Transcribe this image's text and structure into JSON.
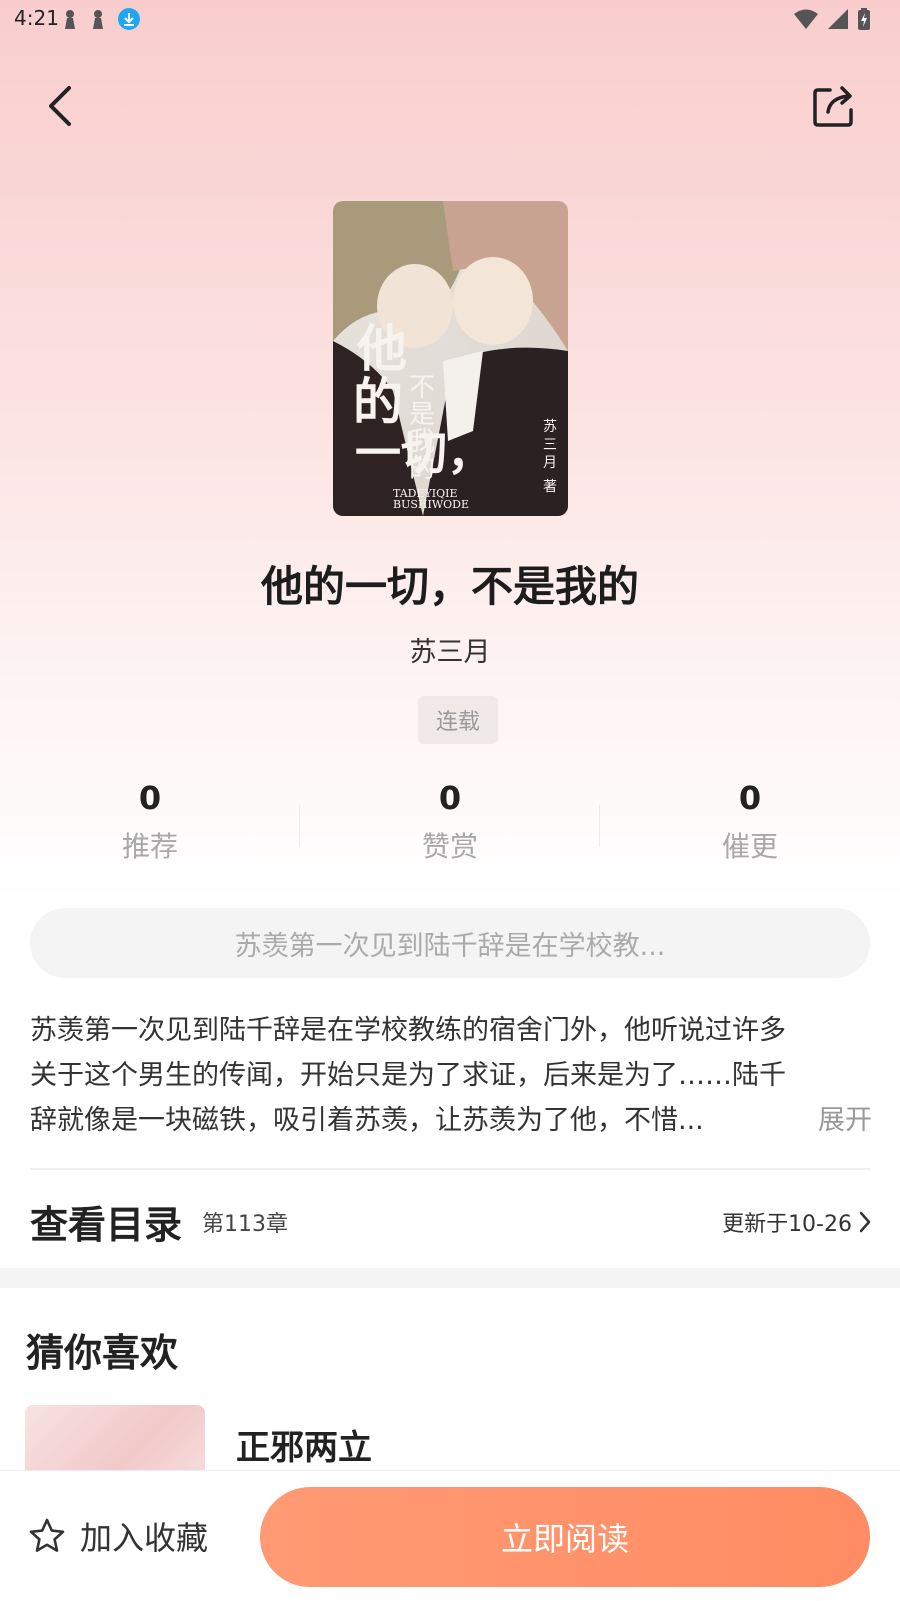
{
  "status_bar": {
    "time": "4:21"
  },
  "icons": {
    "back": "back-arrow-icon",
    "share": "share-icon",
    "favorite": "star-outline-icon",
    "chevron": "chevron-right-icon"
  },
  "book": {
    "cover_title": "他的一切，不是我的",
    "cover_subtitle_1": "TADEYIQIE",
    "cover_subtitle_2": "BUSHIWODE",
    "cover_author": "苏三月 著",
    "title": "他的一切，不是我的",
    "author": "苏三月",
    "status": "连载"
  },
  "stats": [
    {
      "value": "0",
      "label": "推荐"
    },
    {
      "value": "0",
      "label": "赞赏"
    },
    {
      "value": "0",
      "label": "催更"
    }
  ],
  "summary_pill": "苏羡第一次见到陆千辞是在学校教...",
  "description": {
    "line1": "苏羡第一次见到陆千辞是在学校教练的宿舍门外，他听说过许多",
    "line2": "关于这个男生的传闻，开始只是为了求证，后来是为了……陆千",
    "line3": "辞就像是一块磁铁，吸引着苏羡，让苏羡为了他，不惜...",
    "expand": "展开"
  },
  "catalog": {
    "title": "查看目录",
    "chapter": "第113章",
    "updated": "更新于10-26"
  },
  "recommend": {
    "section_title": "猜你喜欢",
    "first_book_title": "正邪两立"
  },
  "bottom_bar": {
    "favorite_label": "加入收藏",
    "read_label": "立即阅读"
  },
  "colors": {
    "accent": "#ff8f66",
    "header_gradient_top": "#f9cdcd"
  }
}
